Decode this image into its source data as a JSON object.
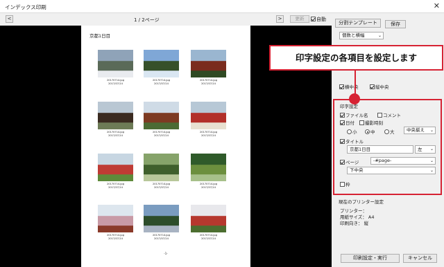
{
  "window": {
    "title": "インデックス印刷",
    "close": "✕"
  },
  "toolbar": {
    "prev": "<",
    "next": ">",
    "page": "1 / 2ページ",
    "update": "更新",
    "auto": "自動",
    "auto_checked": true
  },
  "paper": {
    "title": "京都1日目",
    "page_number": "-1-",
    "thumbs": [
      {
        "file": "20170714.jpg",
        "date": "2017/07/14"
      },
      {
        "file": "20170714.jpg",
        "date": "2017/07/14"
      },
      {
        "file": "20170714.jpg",
        "date": "2017/07/14"
      },
      {
        "file": "20170714.jpg",
        "date": "2017/07/14"
      },
      {
        "file": "20170714.jpg",
        "date": "2017/07/14"
      },
      {
        "file": "20170714.jpg",
        "date": "2017/07/14"
      },
      {
        "file": "20170714.jpg",
        "date": "2017/07/14"
      },
      {
        "file": "20170714.jpg",
        "date": "2017/07/14"
      },
      {
        "file": "20170714.jpg",
        "date": "2017/07/14"
      },
      {
        "file": "20170714.jpg",
        "date": "2017/07/14"
      },
      {
        "file": "20170714.jpg",
        "date": "2017/07/14"
      },
      {
        "file": "20170714.jpg",
        "date": "2017/07/14"
      }
    ]
  },
  "right": {
    "template_btn": "分割テンプレート",
    "save_btn": "保存",
    "layout_select": "個数と横幅",
    "h_center": "横中央",
    "v_center": "縦中央"
  },
  "callout": "印字設定の各項目を設定します",
  "print": {
    "header": "印字設定",
    "filename": "ファイル名",
    "comment": "コメント",
    "date": "日付",
    "shoot_time": "撮影時刻",
    "size_small": "小",
    "size_mid": "中",
    "size_large": "大",
    "align_select": "中央揃え",
    "title_label": "タイトル",
    "title_value": "京都1日目",
    "title_pos": "左",
    "page_label": "ページ",
    "page_format": "-#page-",
    "page_pos": "下中央",
    "frame": "枠"
  },
  "printer": {
    "header": "現在のプリンター設定",
    "printer_label": "プリンター：",
    "paper_label": "用紙サイズ：",
    "paper_value": "A4",
    "orient_label": "印刷向き：",
    "orient_value": "縦"
  },
  "buttons": {
    "print": "印刷設定・実行",
    "cancel": "キャンセル"
  }
}
